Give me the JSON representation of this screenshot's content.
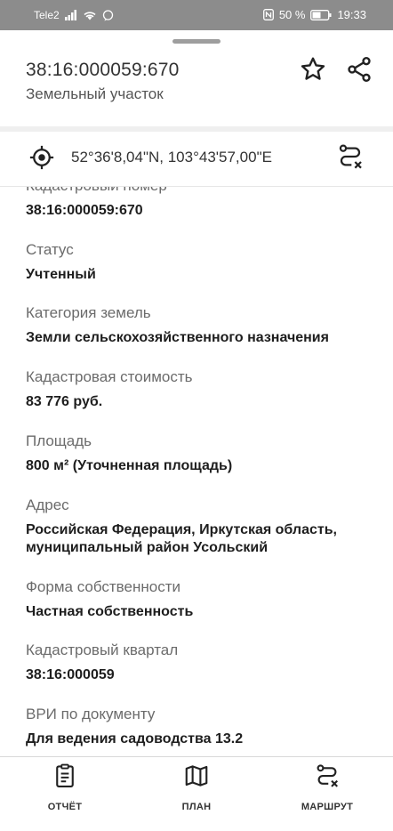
{
  "status_bar": {
    "carrier": "Tele2",
    "battery": "50 %",
    "time": "19:33"
  },
  "header": {
    "title": "38:16:000059:670",
    "subtitle": "Земельный участок"
  },
  "coordinates": {
    "text": "52°36'8,04\"N, 103°43'57,00\"E"
  },
  "fields": [
    {
      "label": "Кадастровый номер",
      "value": "38:16:000059:670"
    },
    {
      "label": "Статус",
      "value": "Учтенный"
    },
    {
      "label": "Категория земель",
      "value": "Земли сельскохозяйственного назначения"
    },
    {
      "label": "Кадастровая стоимость",
      "value": "83 776 руб."
    },
    {
      "label": "Площадь",
      "value": "800 м² (Уточненная площадь)"
    },
    {
      "label": "Адрес",
      "value": "Российская Федерация, Иркутская область, муниципальный район Усольский"
    },
    {
      "label": "Форма собственности",
      "value": "Частная собственность"
    },
    {
      "label": "Кадастровый квартал",
      "value": "38:16:000059"
    },
    {
      "label": "ВРИ по документу",
      "value": "Для ведения садоводства 13.2"
    }
  ],
  "bottom_nav": [
    {
      "label": "ОТЧЁТ",
      "icon": "report-icon"
    },
    {
      "label": "ПЛАН",
      "icon": "map-icon"
    },
    {
      "label": "МАРШРУТ",
      "icon": "route-icon"
    }
  ]
}
